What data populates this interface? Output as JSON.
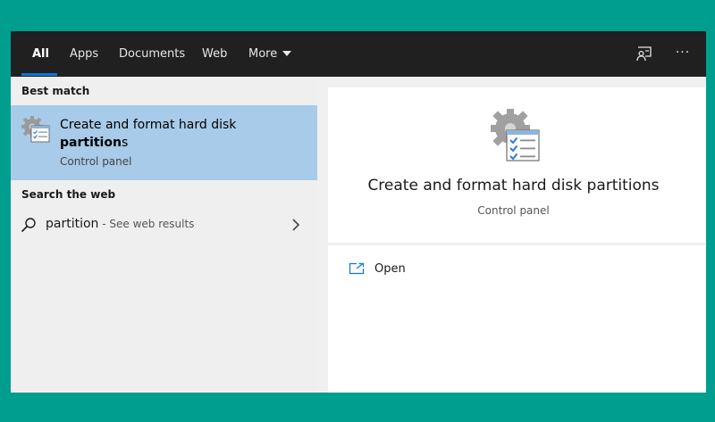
{
  "tabs": [
    {
      "label": "All",
      "active": true
    },
    {
      "label": "Apps"
    },
    {
      "label": "Documents"
    },
    {
      "label": "Web"
    },
    {
      "label": "More"
    }
  ],
  "toolbar": {
    "feedback_icon": "feedback-icon",
    "more_icon": "ellipsis-icon",
    "more_symbol": "···"
  },
  "left": {
    "best_match_label": "Best match",
    "best_match": {
      "title_line1": "Create and format hard disk",
      "title_bold": "partition",
      "title_rest": "s",
      "subtitle": "Control panel",
      "icon": "control-panel-gear-icon"
    },
    "web_label": "Search the web",
    "web_result": {
      "query": "partition",
      "hint": " - See web results",
      "icon": "search-icon"
    }
  },
  "right": {
    "title": "Create and format hard disk partitions",
    "subtitle": "Control panel",
    "open_label": "Open",
    "open_icon": "open-icon"
  },
  "colors": {
    "desktop": "#009e8f",
    "topbar": "#202020",
    "accent": "#0a78d7",
    "selection": "#a7cbe8"
  }
}
